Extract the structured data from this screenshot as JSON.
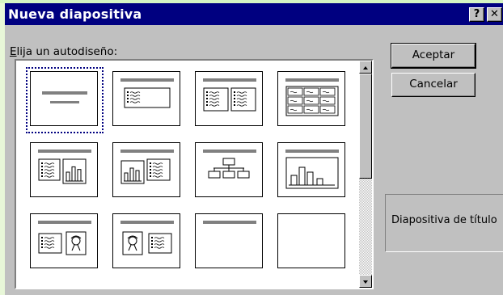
{
  "dialog": {
    "title": "Nueva diapositiva",
    "help_glyph": "?",
    "close_glyph": "✕",
    "prompt_accel": "E",
    "prompt_rest": "lija un autodiseño:",
    "ok_label": "Aceptar",
    "cancel_label": "Cancelar",
    "preview_label": "Diapositiva de título"
  },
  "layouts": [
    {
      "kind": "title",
      "selected": true
    },
    {
      "kind": "bulleted-list"
    },
    {
      "kind": "two-column-text"
    },
    {
      "kind": "table"
    },
    {
      "kind": "text-and-chart"
    },
    {
      "kind": "chart-and-text"
    },
    {
      "kind": "organization-chart"
    },
    {
      "kind": "chart"
    },
    {
      "kind": "text-and-clip-art"
    },
    {
      "kind": "clip-art-and-text"
    },
    {
      "kind": "title-only"
    },
    {
      "kind": "blank"
    }
  ],
  "icons": {
    "scroll_up": "triangle-up-icon",
    "scroll_down": "triangle-down-icon"
  }
}
